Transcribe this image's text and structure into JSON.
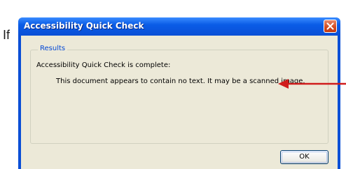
{
  "background": {
    "text": "If"
  },
  "dialog": {
    "title": "Accessibility Quick Check",
    "group_label": "Results",
    "status_line": "Accessibility Quick Check is complete:",
    "message": "This document appears to contain no text. It may be a scanned image.",
    "ok_label": "OK"
  },
  "colors": {
    "titlebar": "#0a4fd6",
    "close_button": "#d2491e",
    "client_bg": "#ece9d8",
    "group_label": "#0046d5",
    "annotation_arrow": "#d01c1c"
  },
  "icons": {
    "close": "close-icon",
    "annotation": "red-arrow-icon"
  }
}
